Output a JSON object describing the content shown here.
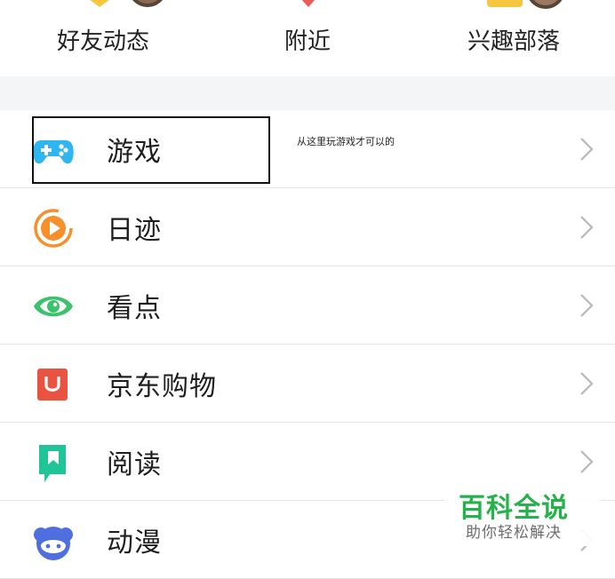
{
  "top_nav": {
    "items": [
      {
        "label": "好友动态"
      },
      {
        "label": "附近"
      },
      {
        "label": "兴趣部落"
      }
    ]
  },
  "menu": {
    "items": [
      {
        "label": "游戏",
        "icon": "gamepad-icon",
        "color": "#2eb6f0"
      },
      {
        "label": "日迹",
        "icon": "play-circle-icon",
        "color": "#f5902a"
      },
      {
        "label": "看点",
        "icon": "eye-icon",
        "color": "#3cc26a"
      },
      {
        "label": "京东购物",
        "icon": "shopping-bag-icon",
        "color": "#e9533f"
      },
      {
        "label": "阅读",
        "icon": "bookmark-book-icon",
        "color": "#1fc596"
      },
      {
        "label": "动漫",
        "icon": "anime-face-icon",
        "color": "#4f6fe0"
      }
    ]
  },
  "annotation": {
    "note": "从这里玩游戏才可以的"
  },
  "watermark": {
    "title": "百科全说",
    "subtitle": "助你轻松解决"
  },
  "colors": {
    "separator": "#f4f5f7",
    "chevron": "#b8b8b8",
    "watermark_green": "#26b24a"
  }
}
